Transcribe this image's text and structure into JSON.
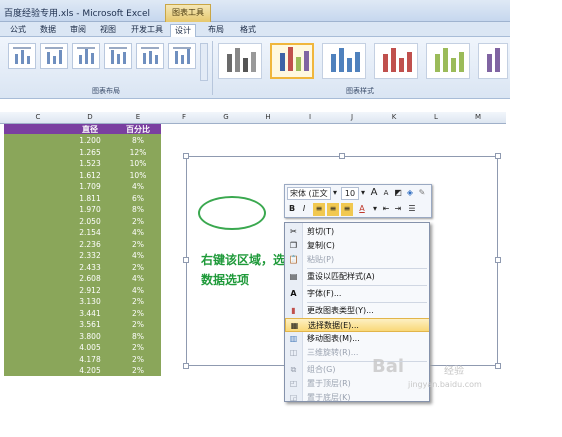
{
  "window": {
    "title": "百度经验专用.xls - Microsoft Excel",
    "context_tab": "图表工具"
  },
  "ribbon": {
    "tabs": [
      "公式",
      "数据",
      "审阅",
      "视图",
      "开发工具",
      "设计",
      "布局",
      "格式"
    ],
    "active_tab": "设计",
    "groups": {
      "chart_layouts": "图表布局",
      "chart_styles": "图表样式"
    }
  },
  "sheet": {
    "columns": [
      "C",
      "D",
      "E",
      "F",
      "G",
      "H",
      "I",
      "J",
      "K",
      "L",
      "M"
    ],
    "headers": {
      "d": "直径",
      "e": "百分比"
    },
    "rows": [
      {
        "d": "1.200",
        "e": "8%"
      },
      {
        "d": "1.265",
        "e": "12%"
      },
      {
        "d": "1.523",
        "e": "10%"
      },
      {
        "d": "1.612",
        "e": "10%"
      },
      {
        "d": "1.709",
        "e": "4%"
      },
      {
        "d": "1.811",
        "e": "6%"
      },
      {
        "d": "1.970",
        "e": "8%"
      },
      {
        "d": "2.050",
        "e": "2%"
      },
      {
        "d": "2.154",
        "e": "4%"
      },
      {
        "d": "2.236",
        "e": "2%"
      },
      {
        "d": "2.332",
        "e": "4%"
      },
      {
        "d": "2.433",
        "e": "2%"
      },
      {
        "d": "2.608",
        "e": "4%"
      },
      {
        "d": "2.912",
        "e": "4%"
      },
      {
        "d": "3.130",
        "e": "2%"
      },
      {
        "d": "3.441",
        "e": "2%"
      },
      {
        "d": "3.561",
        "e": "2%"
      },
      {
        "d": "3.800",
        "e": "8%"
      },
      {
        "d": "4.005",
        "e": "2%"
      },
      {
        "d": "4.178",
        "e": "2%"
      },
      {
        "d": "4.205",
        "e": "2%"
      }
    ]
  },
  "annotation": {
    "line1": "右键该区域，选择选择",
    "line2": "数据选项"
  },
  "minitoolbar": {
    "font": "宋体 (正文",
    "size": "10",
    "grow": "A",
    "shrink": "A",
    "bold": "B",
    "italic": "I"
  },
  "context_menu": [
    {
      "label": "剪切(T)",
      "icon": "scissors-icon",
      "disabled": false
    },
    {
      "label": "复制(C)",
      "icon": "copy-icon",
      "disabled": false
    },
    {
      "label": "粘贴(P)",
      "icon": "paste-icon",
      "disabled": true
    },
    {
      "label": "重设以匹配样式(A)",
      "icon": "reset-style-icon",
      "disabled": false
    },
    {
      "label": "字体(F)...",
      "icon": "font-icon",
      "disabled": false
    },
    {
      "label": "更改图表类型(Y)...",
      "icon": "chart-type-icon",
      "disabled": false
    },
    {
      "label": "选择数据(E)...",
      "icon": "select-data-icon",
      "disabled": false,
      "highlighted": true
    },
    {
      "label": "移动图表(M)...",
      "icon": "move-chart-icon",
      "disabled": false
    },
    {
      "label": "三维旋转(R)...",
      "icon": "rotate-3d-icon",
      "disabled": true
    },
    {
      "label": "组合(G)",
      "icon": "group-icon",
      "disabled": true
    },
    {
      "label": "置于顶层(R)",
      "icon": "bring-front-icon",
      "disabled": true
    },
    {
      "label": "置于底层(K)",
      "icon": "send-back-icon",
      "disabled": true
    }
  ],
  "watermark": {
    "logo": "Bai",
    "text": "经验",
    "url": "jingyan.baidu.com"
  }
}
